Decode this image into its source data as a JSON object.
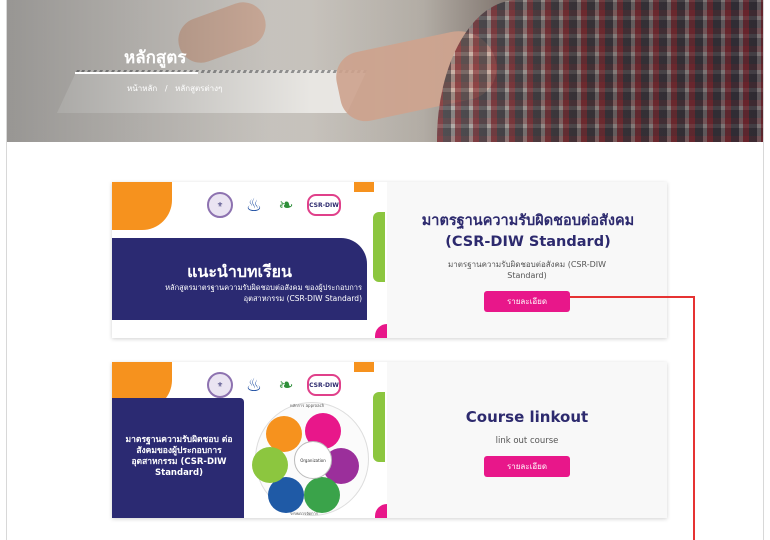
{
  "hero": {
    "title": "หลักสูตร",
    "breadcrumb": [
      "หน้าหลัก",
      "/",
      "หลักสูตรต่างๆ"
    ]
  },
  "courses": [
    {
      "thumb_title": "แนะนำบทเรียน",
      "thumb_subtitle": "หลักสูตรมาตรฐานความรับผิดชอบต่อสังคม ของผู้ประกอบการอุตสาหกรรม (CSR-DIW Standard)",
      "title": "มาตรฐานความรับผิดชอบต่อสังคม (CSR-DIW Standard)",
      "description": "มาตรฐานความรับผิดชอบต่อสังคม (CSR-DIW Standard)",
      "button": "รายละเอียด"
    },
    {
      "thumb_title": "มาตรฐานความรับผิดชอบ ต่อสังคมของผู้ประกอบการ อุตสาหกรรม (CSR-DIW Standard)",
      "wheel_top": "หลักการ approach",
      "wheel_bottom": "ระบบการจัดการ",
      "wheel_center": "Organization",
      "title": "Course linkout",
      "description": "link out course",
      "button": "รายละเอียด"
    }
  ],
  "logo_badge": "CSR-DIW",
  "colors": {
    "navy": "#2b2a72",
    "pink": "#e8178a",
    "orange": "#f6921e",
    "green": "#8cc63f",
    "annotation": "#e63232"
  }
}
